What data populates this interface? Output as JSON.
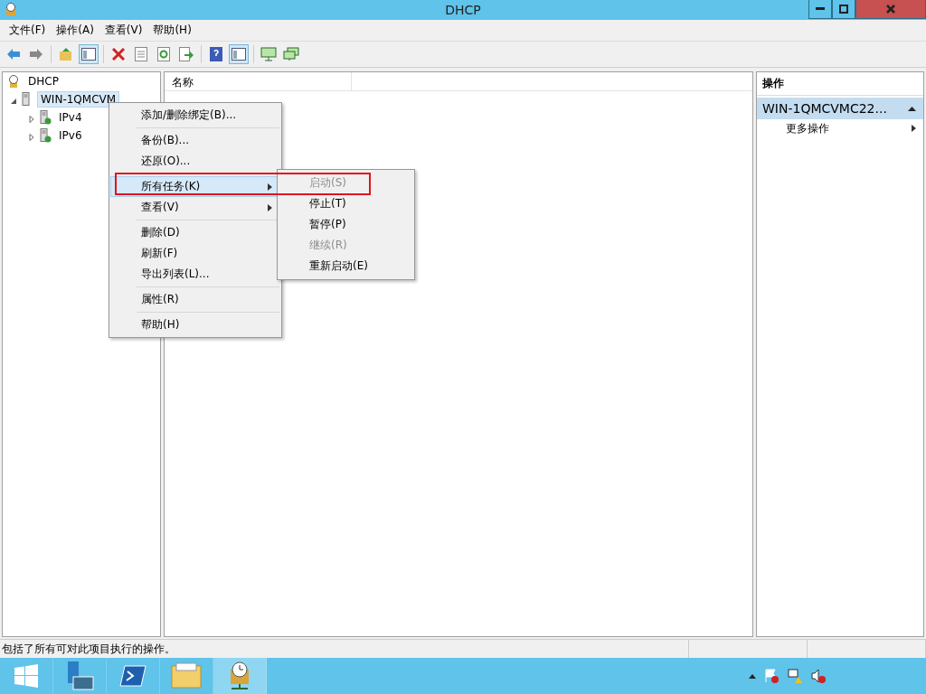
{
  "window": {
    "title": "DHCP"
  },
  "menu_bar": [
    "文件(F)",
    "操作(A)",
    "查看(V)",
    "帮助(H)"
  ],
  "toolbar": [
    [
      {
        "kind": "back"
      },
      {
        "kind": "forward"
      }
    ],
    [
      {
        "kind": "up"
      },
      {
        "kind": "pane",
        "selected": true
      }
    ],
    [
      {
        "kind": "delete"
      },
      {
        "kind": "props"
      },
      {
        "kind": "refresh"
      },
      {
        "kind": "export"
      }
    ],
    [
      {
        "kind": "help"
      },
      {
        "kind": "pane",
        "selected": true
      }
    ],
    [
      {
        "kind": "monitor"
      },
      {
        "kind": "monitors"
      }
    ]
  ],
  "tree": {
    "root": "DHCP",
    "children": [
      {
        "label": "WIN-1QMCVM",
        "selected": true,
        "expanded": true,
        "children": [
          {
            "label": "IPv4",
            "expanded": false
          },
          {
            "label": "IPv6",
            "expanded": false
          }
        ]
      }
    ]
  },
  "content": {
    "columns": [
      "名称"
    ]
  },
  "actions": {
    "title": "操作",
    "section": "WIN-1QMCVMC22...",
    "items": [
      "更多操作"
    ]
  },
  "context_menu": [
    {
      "kind": "item",
      "label": "添加/删除绑定(B)...",
      "selected": false,
      "submenu": false
    },
    {
      "kind": "separator"
    },
    {
      "kind": "item",
      "label": "备份(B)...",
      "selected": false,
      "submenu": false
    },
    {
      "kind": "item",
      "label": "还原(O)...",
      "selected": false,
      "submenu": false
    },
    {
      "kind": "separator"
    },
    {
      "kind": "item",
      "label": "所有任务(K)",
      "selected": true,
      "submenu": true
    },
    {
      "kind": "item",
      "label": "查看(V)",
      "selected": false,
      "submenu": true
    },
    {
      "kind": "separator"
    },
    {
      "kind": "item",
      "label": "删除(D)",
      "selected": false,
      "submenu": false
    },
    {
      "kind": "item",
      "label": "刷新(F)",
      "selected": false,
      "submenu": false
    },
    {
      "kind": "item",
      "label": "导出列表(L)...",
      "selected": false,
      "submenu": false
    },
    {
      "kind": "separator"
    },
    {
      "kind": "item",
      "label": "属性(R)",
      "selected": false,
      "submenu": false
    },
    {
      "kind": "separator"
    },
    {
      "kind": "item",
      "label": "帮助(H)",
      "selected": false,
      "submenu": false
    }
  ],
  "submenu": [
    {
      "label": "启动(S)",
      "disabled": true
    },
    {
      "label": "停止(T)",
      "disabled": false
    },
    {
      "label": "暂停(P)",
      "disabled": false
    },
    {
      "label": "继续(R)",
      "disabled": true
    },
    {
      "label": "重新启动(E)",
      "disabled": false
    }
  ],
  "status_bar": "包括了所有可对此项目执行的操作。",
  "taskbar": [
    {
      "kind": "start",
      "selected": false
    },
    {
      "kind": "server",
      "selected": false
    },
    {
      "kind": "shell",
      "selected": false
    },
    {
      "kind": "folder",
      "selected": false
    },
    {
      "kind": "dhcp",
      "selected": true
    }
  ]
}
